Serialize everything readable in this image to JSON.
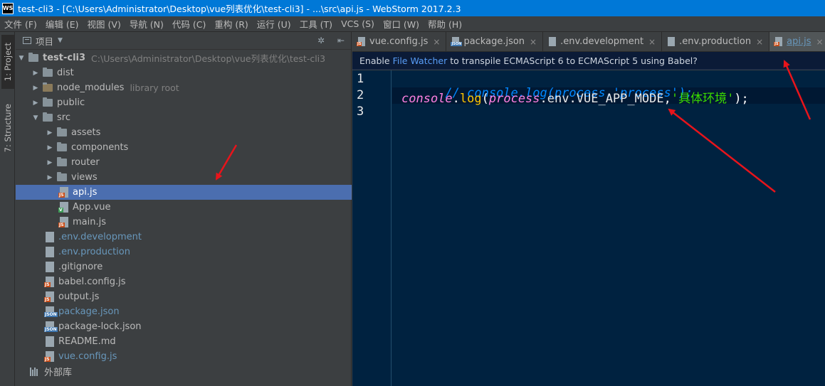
{
  "window": {
    "logo": "WS",
    "title": "test-cli3 - [C:\\Users\\Administrator\\Desktop\\vue列表优化\\test-cli3] - ...\\src\\api.js - WebStorm 2017.2.3"
  },
  "menu": [
    "文件 (F)",
    "编辑 (E)",
    "视图 (V)",
    "导航 (N)",
    "代码 (C)",
    "重构 (R)",
    "运行 (U)",
    "工具 (T)",
    "VCS (S)",
    "窗口 (W)",
    "帮助 (H)"
  ],
  "side_tabs": {
    "project": "1: Project",
    "structure": "7: Structure"
  },
  "project_panel": {
    "label": "项目",
    "tree": [
      {
        "name": "test-cli3",
        "hint": "C:\\Users\\Administrator\\Desktop\\vue列表优化\\test-cli3"
      },
      {
        "name": "dist"
      },
      {
        "name": "node_modules",
        "hint": "library root"
      },
      {
        "name": "public"
      },
      {
        "name": "src"
      },
      {
        "name": "assets"
      },
      {
        "name": "components"
      },
      {
        "name": "router"
      },
      {
        "name": "views"
      },
      {
        "name": "api.js",
        "tag": "JS"
      },
      {
        "name": "App.vue",
        "tag": "V"
      },
      {
        "name": "main.js",
        "tag": "JS"
      },
      {
        "name": ".env.development"
      },
      {
        "name": ".env.production"
      },
      {
        "name": ".gitignore"
      },
      {
        "name": "babel.config.js",
        "tag": "JS"
      },
      {
        "name": "output.js",
        "tag": "JS"
      },
      {
        "name": "package.json",
        "tag": "JSON"
      },
      {
        "name": "package-lock.json",
        "tag": "JSON"
      },
      {
        "name": "README.md"
      },
      {
        "name": "vue.config.js",
        "tag": "JS"
      },
      {
        "name": "外部库"
      }
    ]
  },
  "tabs": [
    {
      "label": "vue.config.js",
      "tag": "JS",
      "close": "×"
    },
    {
      "label": "package.json",
      "tag": "JSON",
      "close": "×"
    },
    {
      "label": ".env.development",
      "close": "×"
    },
    {
      "label": ".env.production",
      "close": "×"
    },
    {
      "label": "api.js",
      "tag": "JS",
      "close": "×"
    }
  ],
  "banner": {
    "prefix": "Enable",
    "link": "File Watcher",
    "suffix": "to transpile ECMAScript 6 to ECMAScript 5 using Babel?"
  },
  "code": {
    "line_numbers": [
      "1",
      "2",
      "3"
    ],
    "line1": {
      "comment": "// console.log(process,'process');"
    },
    "line2": {
      "obj": "console",
      "dot1": ".",
      "fn": "log",
      "open": "(",
      "process": "process",
      "dot2": ".",
      "env": "env",
      "dot3": ".",
      "mode": "VUE_APP_MODE",
      "comma": ",",
      "str": "'具体环境'",
      "close": ");"
    }
  },
  "colors": {
    "titlebar": "#0078d7",
    "editor_bg": "#002240",
    "selection": "#4b6eaf",
    "annotation_arrow": "#e8141b"
  }
}
